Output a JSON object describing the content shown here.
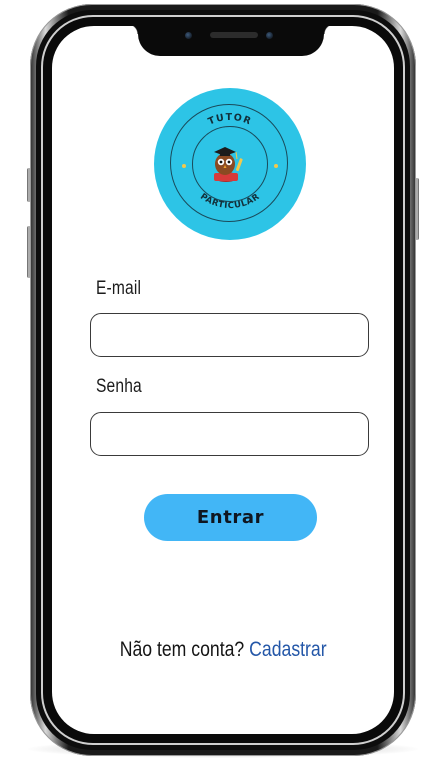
{
  "logo": {
    "text_top": "TUTOR",
    "text_bottom": "PARTICULAR",
    "icon": "owl-graduate-icon",
    "background_color": "#2dc4e6"
  },
  "login_form": {
    "email_label": "E-mail",
    "email_value": "",
    "password_label": "Senha",
    "password_value": "",
    "submit_label": "Entrar",
    "submit_color": "#42b6f6"
  },
  "signup": {
    "prompt": "Não tem conta?",
    "link_label": "Cadastrar",
    "link_color": "#2457a8"
  }
}
